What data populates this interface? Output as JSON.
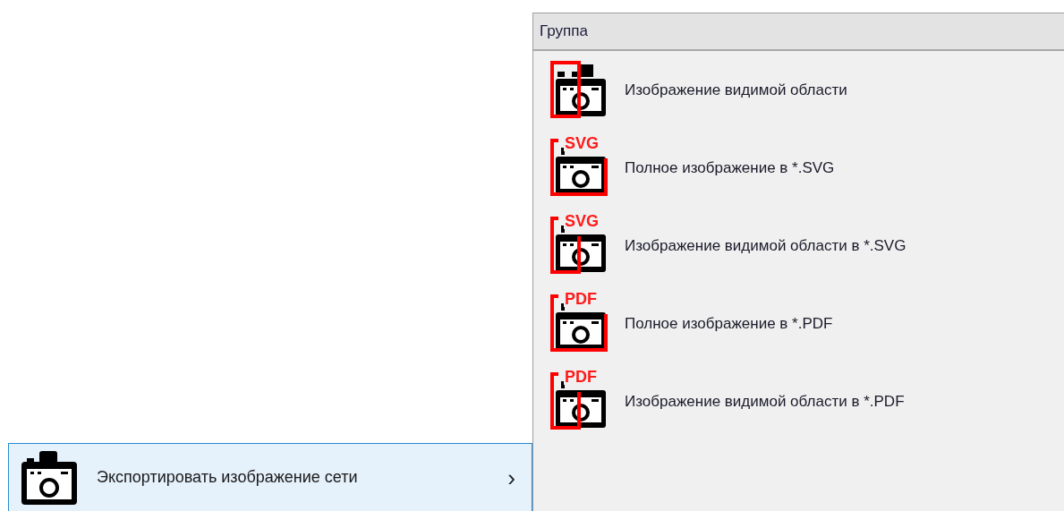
{
  "menu_item": {
    "label": "Экспортировать изображение сети",
    "arrow": "›",
    "selected": true
  },
  "submenu": {
    "header": "Группа",
    "items": [
      {
        "label": "Изображение видимой области",
        "kind": "visible"
      },
      {
        "label": "Полное изображение в *.SVG",
        "kind": "full",
        "badge": "SVG"
      },
      {
        "label": "Изображение видимой области в *.SVG",
        "kind": "visible",
        "badge": "SVG"
      },
      {
        "label": "Полное изображение в *.PDF",
        "kind": "full",
        "badge": "PDF"
      },
      {
        "label": "Изображение видимой области в *.PDF",
        "kind": "visible",
        "badge": "PDF"
      }
    ]
  }
}
